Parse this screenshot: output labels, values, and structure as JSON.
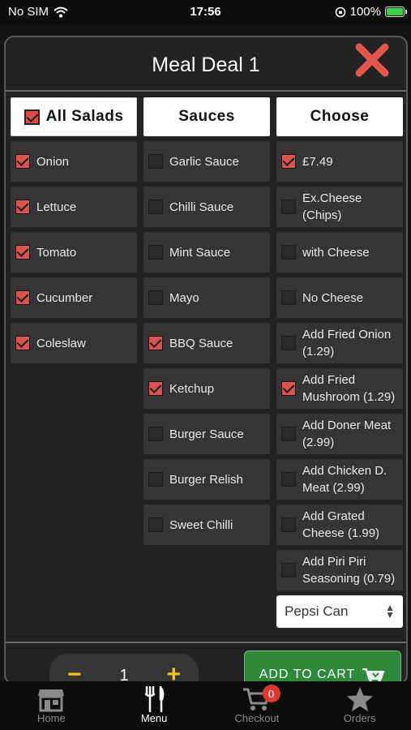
{
  "status_bar": {
    "carrier": "No SIM",
    "time": "17:56",
    "battery": "100%"
  },
  "modal": {
    "title": "Meal Deal 1"
  },
  "salads": {
    "header": "All Salads",
    "header_checked": true,
    "items": [
      {
        "label": "Onion",
        "checked": true
      },
      {
        "label": "Lettuce",
        "checked": true
      },
      {
        "label": "Tomato",
        "checked": true
      },
      {
        "label": "Cucumber",
        "checked": true
      },
      {
        "label": "Coleslaw",
        "checked": true
      }
    ]
  },
  "sauces": {
    "header": "Sauces",
    "items": [
      {
        "label": "Garlic Sauce",
        "checked": false
      },
      {
        "label": "Chilli Sauce",
        "checked": false
      },
      {
        "label": "Mint Sauce",
        "checked": false
      },
      {
        "label": "Mayo",
        "checked": false
      },
      {
        "label": "BBQ Sauce",
        "checked": true
      },
      {
        "label": "Ketchup",
        "checked": true
      },
      {
        "label": "Burger Sauce",
        "checked": false
      },
      {
        "label": "Burger Relish",
        "checked": false
      },
      {
        "label": "Sweet Chilli",
        "checked": false
      }
    ]
  },
  "choose": {
    "header": "Choose",
    "items": [
      {
        "label": "£7.49",
        "checked": true
      },
      {
        "label": "Ex.Cheese (Chips)",
        "checked": false
      },
      {
        "label": "with Cheese",
        "checked": false
      },
      {
        "label": "No Cheese",
        "checked": false
      },
      {
        "label": "Add Fried Onion (1.29)",
        "checked": false
      },
      {
        "label": "Add Fried Mushroom (1.29)",
        "checked": true
      },
      {
        "label": "Add Doner Meat (2.99)",
        "checked": false
      },
      {
        "label": "Add Chicken D. Meat (2.99)",
        "checked": false
      },
      {
        "label": "Add Grated Cheese (1.99)",
        "checked": false
      },
      {
        "label": "Add Piri Piri Seasoning (0.79)",
        "checked": false
      }
    ],
    "drink_select": "Pepsi Can"
  },
  "cart_controls": {
    "quantity": "1",
    "minus": "−",
    "plus": "+",
    "add_label": "ADD TO CART"
  },
  "tabbar": {
    "tabs": [
      {
        "label": "Home",
        "icon": "store-icon",
        "active": false
      },
      {
        "label": "Menu",
        "icon": "fork-knife-icon",
        "active": true
      },
      {
        "label": "Checkout",
        "icon": "cart-icon",
        "active": false,
        "badge": "0"
      },
      {
        "label": "Orders",
        "icon": "star-icon",
        "active": false
      }
    ]
  },
  "colors": {
    "accent_red": "#d9534f",
    "cart_green": "#2e8a3a",
    "stepper_yellow": "#f2c01e",
    "background": "#232323"
  }
}
